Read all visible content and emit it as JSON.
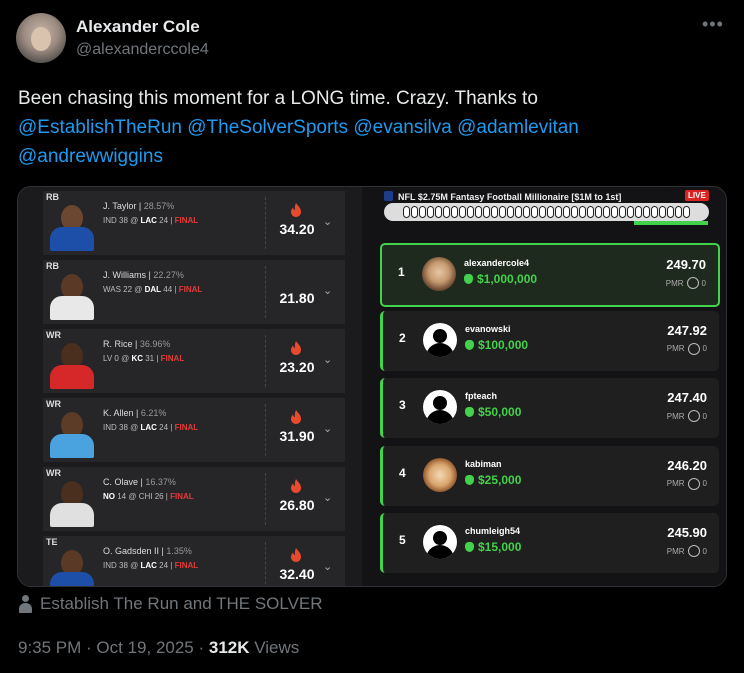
{
  "author": {
    "name": "Alexander Cole",
    "handle": "@alexanderccole4",
    "more_icon": "more-icon"
  },
  "tweet": {
    "text_part1": "Been chasing this moment for a LONG time.  Crazy.  Thanks to",
    "mentions": [
      "@EstablishTheRun",
      "@TheSolverSports",
      "@evansilva",
      "@adamlevitan",
      "@andrewwiggins"
    ]
  },
  "lineup": [
    {
      "pos": "RB",
      "name": "J. Taylor",
      "pct": "28.57%",
      "game_pre": "IND 38 @ ",
      "game_bold": "LAC",
      "game_post": " 24 | ",
      "status": "FINAL",
      "score": "34.20",
      "flame": true,
      "jersey": "#1e4fa8",
      "skin": "#6b4630"
    },
    {
      "pos": "RB",
      "name": "J. Williams",
      "pct": "22.27%",
      "game_pre": "WAS 22 @ ",
      "game_bold": "DAL",
      "game_post": " 44 | ",
      "status": "FINAL",
      "score": "21.80",
      "flame": false,
      "jersey": "#e8e8e8",
      "skin": "#5a3a26"
    },
    {
      "pos": "WR",
      "name": "R. Rice",
      "pct": "36.96%",
      "game_pre": "LV 0 @ ",
      "game_bold": "KC",
      "game_post": " 31 | ",
      "status": "FINAL",
      "score": "23.20",
      "flame": true,
      "jersey": "#d62828",
      "skin": "#4a2e1e"
    },
    {
      "pos": "WR",
      "name": "K. Allen",
      "pct": "6.21%",
      "game_pre": "IND 38 @ ",
      "game_bold": "LAC",
      "game_post": " 24 | ",
      "status": "FINAL",
      "score": "31.90",
      "flame": true,
      "jersey": "#4aa3df",
      "skin": "#5c3b27"
    },
    {
      "pos": "WR",
      "name": "C. Olave",
      "pct": "16.37%",
      "game_pre": "",
      "game_bold": "NO",
      "game_post": " 14 @ CHI 26 | ",
      "status": "FINAL",
      "score": "26.80",
      "flame": true,
      "jersey": "#e0e0e0",
      "skin": "#4a2e1e"
    },
    {
      "pos": "TE",
      "name": "O. Gadsden II",
      "pct": "1.35%",
      "game_pre": "IND 38 @ ",
      "game_bold": "LAC",
      "game_post": " 24 | ",
      "status": "FINAL",
      "score": "32.40",
      "flame": true,
      "jersey": "#1e4fa8",
      "skin": "#5a3a26"
    }
  ],
  "contest": {
    "title": "NFL $2.75M Fantasy Football Millionaire [$1M to 1st]",
    "live_label": "LIVE",
    "accent": "#43d24b",
    "standings": [
      {
        "rank": "1",
        "user": "alexandercole4",
        "prize": "$1,000,000",
        "points": "249.70",
        "pmr_label": "PMR",
        "pmr": "0",
        "avatar": "photo"
      },
      {
        "rank": "2",
        "user": "evanowski",
        "prize": "$100,000",
        "points": "247.92",
        "pmr_label": "PMR",
        "pmr": "0",
        "avatar": "default"
      },
      {
        "rank": "3",
        "user": "fpteach",
        "prize": "$50,000",
        "points": "247.40",
        "pmr_label": "PMR",
        "pmr": "0",
        "avatar": "default"
      },
      {
        "rank": "4",
        "user": "kabiman",
        "prize": "$25,000",
        "points": "246.20",
        "pmr_label": "PMR",
        "pmr": "0",
        "avatar": "photo2"
      },
      {
        "rank": "5",
        "user": "chumleigh54",
        "prize": "$15,000",
        "points": "245.90",
        "pmr_label": "PMR",
        "pmr": "0",
        "avatar": "default"
      }
    ]
  },
  "source": {
    "text": "Establish The Run and THE SOLVER",
    "icon": "person-icon"
  },
  "meta": {
    "time": "9:35 PM",
    "sep": " · ",
    "date": "Oct 19, 2025",
    "sep2": " · ",
    "views": "312K",
    "views_label": " Views"
  }
}
